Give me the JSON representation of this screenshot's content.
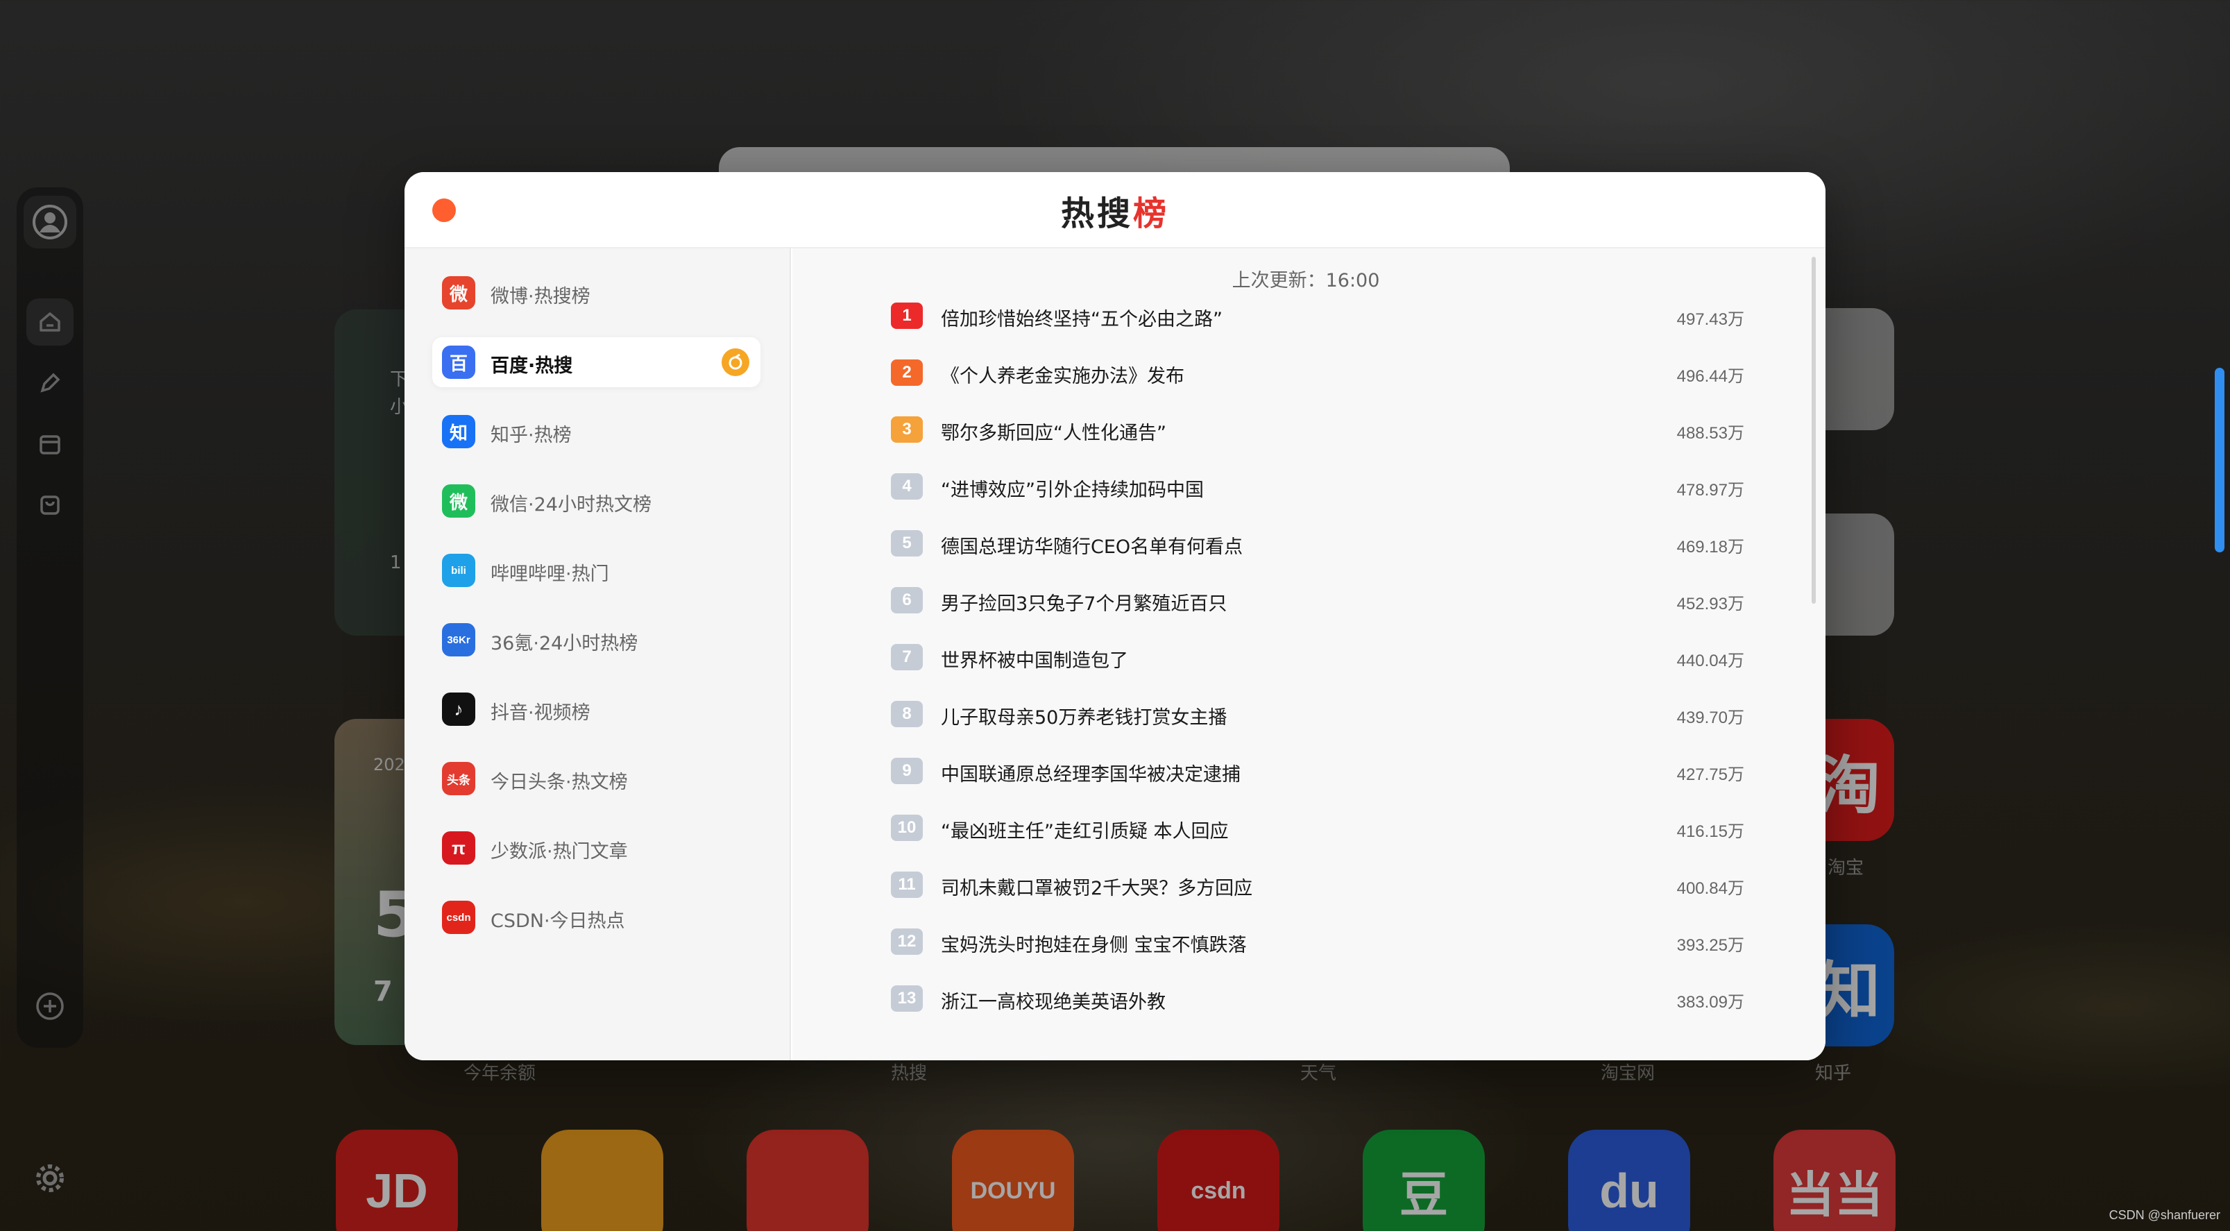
{
  "modal": {
    "title_main": "热搜",
    "title_accent": "榜",
    "updated_label": "上次更新：16:00"
  },
  "sources": [
    {
      "label": "微博·热搜榜",
      "color": "#e6442c",
      "icon": "weibo-icon",
      "glyph": "微"
    },
    {
      "label": "百度·热搜",
      "color": "#3a6ff2",
      "icon": "baidu-paw-icon",
      "glyph": "百",
      "active": true
    },
    {
      "label": "知乎·热榜",
      "color": "#1772f6",
      "icon": "zhihu-icon",
      "glyph": "知"
    },
    {
      "label": "微信·24小时热文榜",
      "color": "#1fbe5b",
      "icon": "wechat-icon",
      "glyph": "微"
    },
    {
      "label": "哔哩哔哩·热门",
      "color": "#1ea1e8",
      "icon": "bilibili-icon",
      "glyph": "bili"
    },
    {
      "label": "36氪·24小时热榜",
      "color": "#2a6fe0",
      "icon": "36kr-icon",
      "glyph": "36Kr"
    },
    {
      "label": "抖音·视频榜",
      "color": "#111111",
      "icon": "douyin-icon",
      "glyph": "♪"
    },
    {
      "label": "今日头条·热文榜",
      "color": "#e33b2f",
      "icon": "toutiao-icon",
      "glyph": "头条"
    },
    {
      "label": "少数派·热门文章",
      "color": "#d7191f",
      "icon": "sspai-icon",
      "glyph": "π"
    },
    {
      "label": "CSDN·今日热点",
      "color": "#e2251b",
      "icon": "csdn-icon",
      "glyph": "csdn"
    }
  ],
  "items": [
    {
      "rank": "1",
      "title": "倍加珍惜始终坚持“五个必由之路”",
      "heat": "497.43万",
      "color": "#ec2a2a"
    },
    {
      "rank": "2",
      "title": "《个人养老金实施办法》发布",
      "heat": "496.44万",
      "color": "#f4692a"
    },
    {
      "rank": "3",
      "title": "鄂尔多斯回应“人性化通告”",
      "heat": "488.53万",
      "color": "#f5a23a"
    },
    {
      "rank": "4",
      "title": "“进博效应”引外企持续加码中国",
      "heat": "478.97万",
      "color": "#c5ccd6"
    },
    {
      "rank": "5",
      "title": "德国总理访华随行CEO名单有何看点",
      "heat": "469.18万",
      "color": "#c5ccd6"
    },
    {
      "rank": "6",
      "title": "男子捡回3只兔子7个月繁殖近百只",
      "heat": "452.93万",
      "color": "#c5ccd6"
    },
    {
      "rank": "7",
      "title": "世界杯被中国制造包了",
      "heat": "440.04万",
      "color": "#c5ccd6"
    },
    {
      "rank": "8",
      "title": "儿子取母亲50万养老钱打赏女主播",
      "heat": "439.70万",
      "color": "#c5ccd6"
    },
    {
      "rank": "9",
      "title": "中国联通原总经理李国华被决定逮捕",
      "heat": "427.75万",
      "color": "#c5ccd6"
    },
    {
      "rank": "10",
      "title": "“最凶班主任”走红引质疑 本人回应",
      "heat": "416.15万",
      "color": "#c5ccd6"
    },
    {
      "rank": "11",
      "title": "司机未戴口罩被罚2千大哭？多方回应",
      "heat": "400.84万",
      "color": "#c5ccd6"
    },
    {
      "rank": "12",
      "title": "宝妈洗头时抱娃在身侧 宝宝不慎跌落",
      "heat": "393.25万",
      "color": "#c5ccd6"
    },
    {
      "rank": "13",
      "title": "浙江一高校现绝美英语外教",
      "heat": "383.09万",
      "color": "#c5ccd6"
    }
  ],
  "background": {
    "widget_labels": [
      "今年余额",
      "热搜",
      "天气",
      "淘宝网",
      "知乎"
    ],
    "side_tile_labels": [
      "淘宝",
      "知乎"
    ],
    "side_tile_glyphs": [
      "淘",
      "知"
    ],
    "dock_tiles": [
      {
        "glyph": "JD",
        "color": "#d6211d",
        "icon": "jd-icon"
      },
      {
        "glyph": "",
        "color": "#f0a020",
        "icon": "huya-icon"
      },
      {
        "glyph": "",
        "color": "#e3352d",
        "icon": "weibo-icon"
      },
      {
        "glyph": "DOUYU",
        "color": "#f05a1e",
        "icon": "douyu-icon"
      },
      {
        "glyph": "csdn",
        "color": "#d51a18",
        "icon": "csdn-icon"
      },
      {
        "glyph": "豆",
        "color": "#14a33a",
        "icon": "douban-icon"
      },
      {
        "glyph": "du",
        "color": "#2b5fe0",
        "icon": "baidu-icon"
      },
      {
        "glyph": "当当",
        "color": "#e13a3a",
        "icon": "dangdang-icon"
      }
    ],
    "left_widget_fragments": [
      "下",
      "小",
      "1"
    ],
    "year_widget_fragments": [
      "202",
      "5",
      "7"
    ]
  },
  "watermark": "CSDN @shanfuerer"
}
